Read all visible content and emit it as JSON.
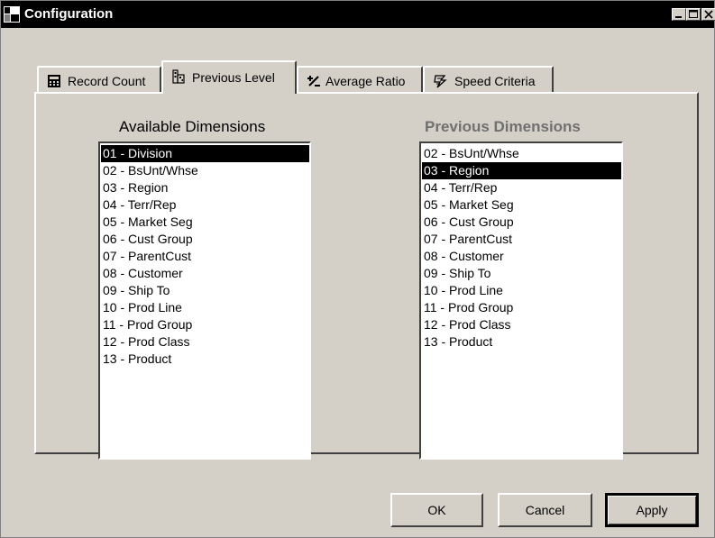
{
  "window": {
    "title": "Configuration",
    "controls": [
      "minimize-icon",
      "maximize-icon",
      "close-icon"
    ]
  },
  "tabs": [
    {
      "label": "Record Count",
      "icon": "calculator-icon",
      "active": false
    },
    {
      "label": "Previous Level",
      "icon": "building-icon",
      "active": true
    },
    {
      "label": "Average Ratio",
      "icon": "plus-minus-icon",
      "active": false
    },
    {
      "label": "Speed Criteria",
      "icon": "speed-icon",
      "active": false
    }
  ],
  "available": {
    "title": "Available Dimensions",
    "items": [
      "01 - Division",
      "02 - BsUnt/Whse",
      "03 - Region",
      "04 - Terr/Rep",
      "05 - Market Seg",
      "06 - Cust Group",
      "07 - ParentCust",
      "08 - Customer",
      "09 - Ship To",
      "10 - Prod Line",
      "11 - Prod Group",
      "12 - Prod Class",
      "13 - Product"
    ],
    "selected": "01 - Division"
  },
  "previous": {
    "title": "Previous Dimensions",
    "items": [
      "02 - BsUnt/Whse",
      "03 - Region",
      "04 - Terr/Rep",
      "05 - Market Seg",
      "06 - Cust Group",
      "07 - ParentCust",
      "08 - Customer",
      "09 - Ship To",
      "10 - Prod Line",
      "11 - Prod Group",
      "12 - Prod Class",
      "13 - Product"
    ],
    "selected": "03 - Region"
  },
  "buttons": {
    "ok": "OK",
    "cancel": "Cancel",
    "apply": "Apply"
  },
  "colors": {
    "face": "#d4d0c8",
    "titlebar": "#000000",
    "selection": "#000000",
    "disabled_text": "#707070"
  }
}
